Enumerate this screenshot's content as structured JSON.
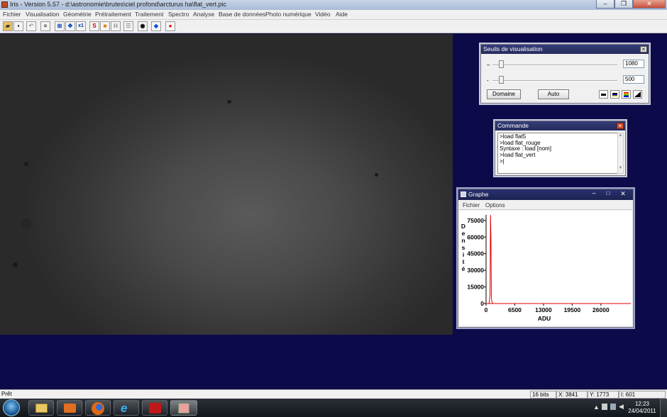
{
  "window": {
    "title": "Iris - Version 5.57 - d:\\astronomie\\brutes\\ciel profond\\arcturus ha\\flat_vert.pic",
    "controls": [
      "–",
      "❐",
      "✕"
    ]
  },
  "menubar": {
    "items": [
      "Fichier",
      "Visualisation",
      "Géométrie",
      "Prétraitement",
      "Traitement",
      "Spectro",
      "Analyse",
      "Base de données",
      "Photo numérique",
      "Vidéo",
      "Aide"
    ]
  },
  "toolbar": {
    "buttons": [
      {
        "name": "open-icon",
        "glyph": "▰"
      },
      {
        "name": "save-icon",
        "glyph": "▪"
      },
      {
        "name": "undo-icon",
        "glyph": "↶"
      },
      {
        "name": "threshold-icon",
        "glyph": "≡"
      },
      {
        "name": "zoom-fit-icon",
        "glyph": "⊞"
      },
      {
        "name": "move-icon",
        "glyph": "✥"
      },
      {
        "name": "zoom-x1-icon",
        "glyph": "x1"
      },
      {
        "name": "sun-icon",
        "glyph": "S"
      },
      {
        "name": "color-icon",
        "glyph": "■"
      },
      {
        "name": "histogram-icon",
        "glyph": "H"
      },
      {
        "name": "list-icon",
        "glyph": "☰"
      },
      {
        "name": "camera-icon",
        "glyph": "◉"
      },
      {
        "name": "star-blue-icon",
        "glyph": "◆"
      },
      {
        "name": "record-icon",
        "glyph": "●"
      }
    ]
  },
  "thresholds": {
    "title": "Seuils de visualisation",
    "high_value": "1080",
    "low_value": "500",
    "high_level": 0.05,
    "low_level": 0.05,
    "domain_button": "Domaine",
    "auto_button": "Auto",
    "palette_icons": [
      "mono-palette-icon",
      "gradient-palette-icon",
      "rainbow-palette-icon",
      "ramp-palette-icon"
    ]
  },
  "command": {
    "title": "Commande",
    "lines": [
      ">load flat5",
      ">load flat_rouge",
      "Syntaxe : load [nom]",
      ">load flat_vert",
      ">|"
    ]
  },
  "graph": {
    "title": "Graphe",
    "menu": [
      "Fichier",
      "Options"
    ],
    "ylabel": "D e n s i t é",
    "xlabel": "ADU"
  },
  "chart_data": {
    "type": "line",
    "xlabel": "ADU",
    "ylabel": "Densité",
    "x_ticks": [
      0,
      6500,
      13000,
      19500,
      26000
    ],
    "y_ticks": [
      0,
      15000,
      30000,
      45000,
      60000,
      75000
    ],
    "xlim": [
      0,
      32767
    ],
    "ylim": [
      0,
      80000
    ],
    "series": [
      {
        "color": "#e00000",
        "x": [
          0,
          400,
          700,
          900,
          1000,
          1100,
          1200,
          1400,
          1700,
          3000,
          10000,
          20000,
          32767
        ],
        "values": [
          0,
          0,
          200,
          8000,
          80000,
          60000,
          5000,
          200,
          50,
          0,
          0,
          0,
          0
        ]
      }
    ]
  },
  "statusbar": {
    "status": "Prêt",
    "bits": "16 bits",
    "x": "X: 3841",
    "y": "Y: 1773",
    "i": "I: 601"
  },
  "taskbar": {
    "time": "12:23",
    "date": "24/04/2011",
    "apps": [
      "start-orb-icon",
      "explorer-icon",
      "media-player-icon",
      "firefox-icon",
      "ie-icon",
      "acrobat-icon",
      "iris-icon"
    ]
  }
}
